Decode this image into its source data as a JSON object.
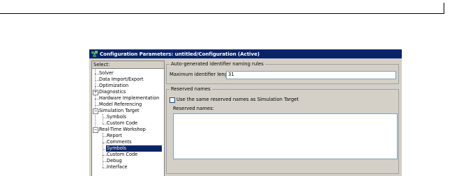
{
  "window": {
    "title": "Configuration Parameters: untitled/Configuration (Active)"
  },
  "tree": {
    "header": "Select:",
    "items": [
      {
        "label": "Solver"
      },
      {
        "label": "Data Import/Export"
      },
      {
        "label": "Optimization"
      },
      {
        "label": "Diagnostics",
        "expander": "+"
      },
      {
        "label": "Hardware Implementation"
      },
      {
        "label": "Model Referencing"
      },
      {
        "label": "Simulation Target",
        "expander": "−"
      },
      {
        "label": "Symbols"
      },
      {
        "label": "Custom Code"
      },
      {
        "label": "Real-Time Workshop",
        "expander": "−"
      },
      {
        "label": "Report"
      },
      {
        "label": "Comments"
      },
      {
        "label": "Symbols",
        "selected": true
      },
      {
        "label": "Custom Code"
      },
      {
        "label": "Debug"
      },
      {
        "label": "Interface"
      }
    ]
  },
  "naming_rules": {
    "title": "Auto-generated identifier naming rules",
    "max_length_label": "Maximum identifier length:",
    "max_length_value": "31"
  },
  "reserved_names": {
    "title": "Reserved names",
    "checkbox_label": "Use the same reserved names as Simulation Target",
    "checkbox_checked": false,
    "text_label": "Reserved names:",
    "text_value": ""
  },
  "colors": {
    "titlebar": "#0a246a",
    "dialog_bg": "#d4d0c8",
    "selection": "#0a246a"
  }
}
